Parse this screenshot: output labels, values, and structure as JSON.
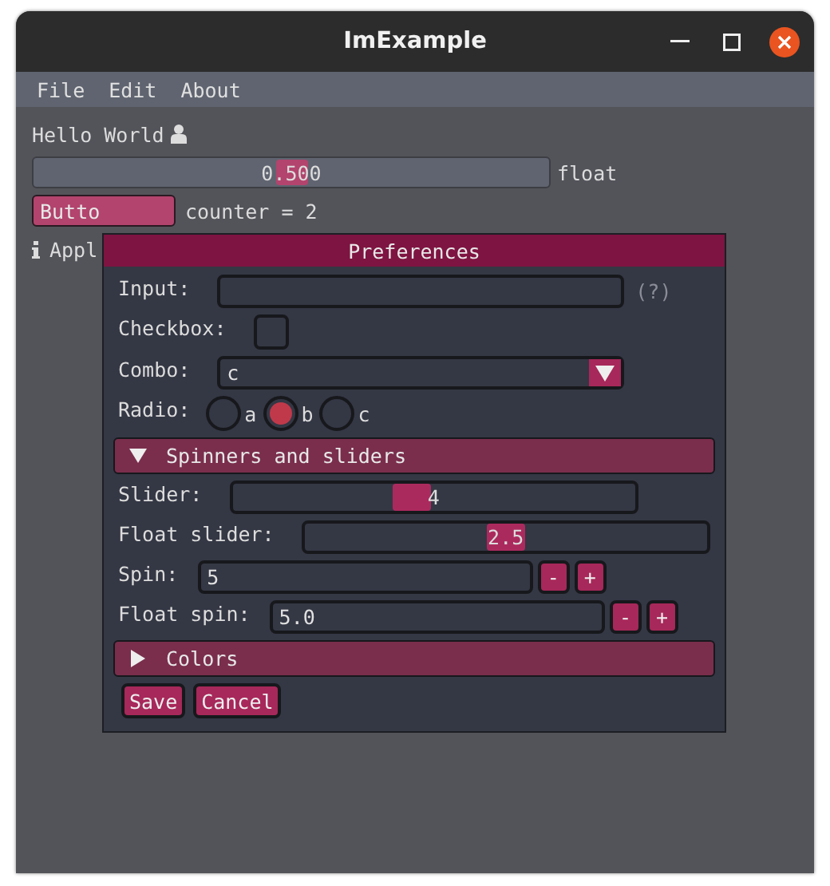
{
  "window": {
    "title": "ImExample"
  },
  "menu": [
    {
      "label": "File"
    },
    {
      "label": "Edit"
    },
    {
      "label": "About"
    }
  ],
  "main": {
    "greeting": "Hello World",
    "float_slider": {
      "value": "0.500",
      "level": 0.5,
      "label": "float"
    },
    "button": {
      "label": "Butto"
    },
    "counter": "counter = 2",
    "info": "Appl"
  },
  "dialog": {
    "title": "Preferences",
    "rows": [
      {
        "kind": "input",
        "label": "Input:",
        "help": "(?)"
      },
      {
        "kind": "checkbox",
        "label": "Checkbox:",
        "checked": false
      },
      {
        "kind": "combo",
        "label": "Combo:",
        "value": "c"
      },
      {
        "kind": "radio",
        "label": "Radio:",
        "options": [
          {
            "label": "a",
            "selected": false
          },
          {
            "label": "b",
            "selected": true
          },
          {
            "label": "c",
            "selected": false
          }
        ]
      },
      {
        "kind": "section",
        "label": "Spinners and sliders",
        "expanded": true,
        "children": [
          {
            "kind": "slider",
            "label": "Slider:",
            "value": "4",
            "level": 0.44
          },
          {
            "kind": "slider",
            "label": "Float slider:",
            "value": "2.5",
            "level": 0.5
          },
          {
            "kind": "spin",
            "label": "Spin:",
            "value": "5",
            "minus": "-",
            "plus": "+"
          },
          {
            "kind": "spin",
            "label": "Float spin:",
            "value": "5.0",
            "minus": "-",
            "plus": "+"
          }
        ]
      },
      {
        "kind": "section",
        "label": "Colors",
        "expanded": false,
        "children": []
      }
    ],
    "buttons": [
      {
        "label": "Save"
      },
      {
        "label": "Cancel"
      }
    ]
  }
}
